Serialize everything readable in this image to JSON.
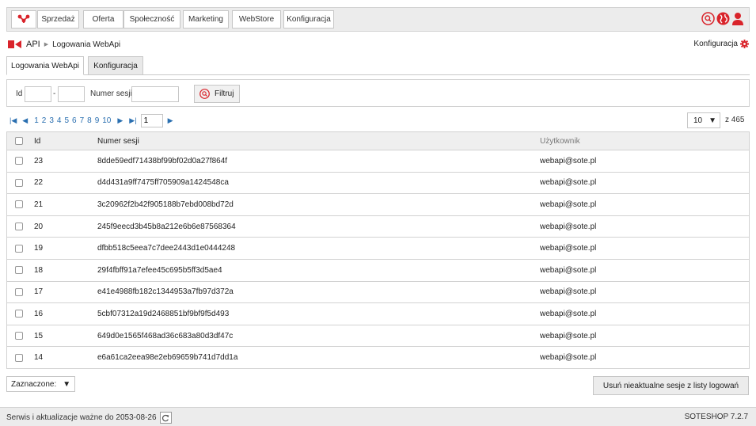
{
  "nav": {
    "logo_icon": "molecule-icon",
    "items": [
      {
        "label": "Sprzedaż"
      },
      {
        "label": "Oferta"
      },
      {
        "label": "Społeczność"
      },
      {
        "label": "Marketing"
      },
      {
        "label": "WebStore"
      },
      {
        "label": "Konfiguracja"
      }
    ],
    "right_icons": [
      "search-icon",
      "globe-icon",
      "user-icon"
    ]
  },
  "breadcrumb": {
    "root": "API",
    "current": "Logowania WebApi"
  },
  "config_link": {
    "label": "Konfiguracja"
  },
  "tabs": [
    {
      "label": "Logowania WebApi",
      "active": true
    },
    {
      "label": "Konfiguracja",
      "active": false
    }
  ],
  "filter": {
    "id_label": "Id",
    "id_from": "",
    "range_sep": "-",
    "id_to": "",
    "session_label": "Numer sesji",
    "session_value": "",
    "button_label": "Filtruj"
  },
  "pager": {
    "pages": [
      "1",
      "2",
      "3",
      "4",
      "5",
      "6",
      "7",
      "8",
      "9",
      "10"
    ],
    "current_page": "1",
    "per_page": "10",
    "total": "z 465"
  },
  "table": {
    "headers": {
      "id": "Id",
      "session": "Numer sesji",
      "user": "Użytkownik"
    },
    "rows": [
      {
        "id": "23",
        "session": "8dde59edf71438bf99bf02d0a27f864f",
        "user": "webapi@sote.pl"
      },
      {
        "id": "22",
        "session": "d4d431a9ff7475ff705909a1424548ca",
        "user": "webapi@sote.pl"
      },
      {
        "id": "21",
        "session": "3c20962f2b42f905188b7ebd008bd72d",
        "user": "webapi@sote.pl"
      },
      {
        "id": "20",
        "session": "245f9eecd3b45b8a212e6b6e87568364",
        "user": "webapi@sote.pl"
      },
      {
        "id": "19",
        "session": "dfbb518c5eea7c7dee2443d1e0444248",
        "user": "webapi@sote.pl"
      },
      {
        "id": "18",
        "session": "29f4fbff91a7efee45c695b5ff3d5ae4",
        "user": "webapi@sote.pl"
      },
      {
        "id": "17",
        "session": "e41e4988fb182c1344953a7fb97d372a",
        "user": "webapi@sote.pl"
      },
      {
        "id": "16",
        "session": "5cbf07312a19d2468851bf9bf9f5d493",
        "user": "webapi@sote.pl"
      },
      {
        "id": "15",
        "session": "649d0e1565f468ad36c683a80d3df47c",
        "user": "webapi@sote.pl"
      },
      {
        "id": "14",
        "session": "e6a61ca2eea98e2eb69659b741d7dd1a",
        "user": "webapi@sote.pl"
      }
    ]
  },
  "bulk_action": {
    "label": "Zaznaczone:"
  },
  "purge_button": {
    "label": "Usuń nieaktualne sesje z listy logowań"
  },
  "footer": {
    "service_text": "Serwis i aktualizacje ważne do 2053-08-26",
    "version": "SOTESHOP 7.2.7"
  },
  "colors": {
    "accent": "#d9242b",
    "link": "#2a6fb0"
  }
}
